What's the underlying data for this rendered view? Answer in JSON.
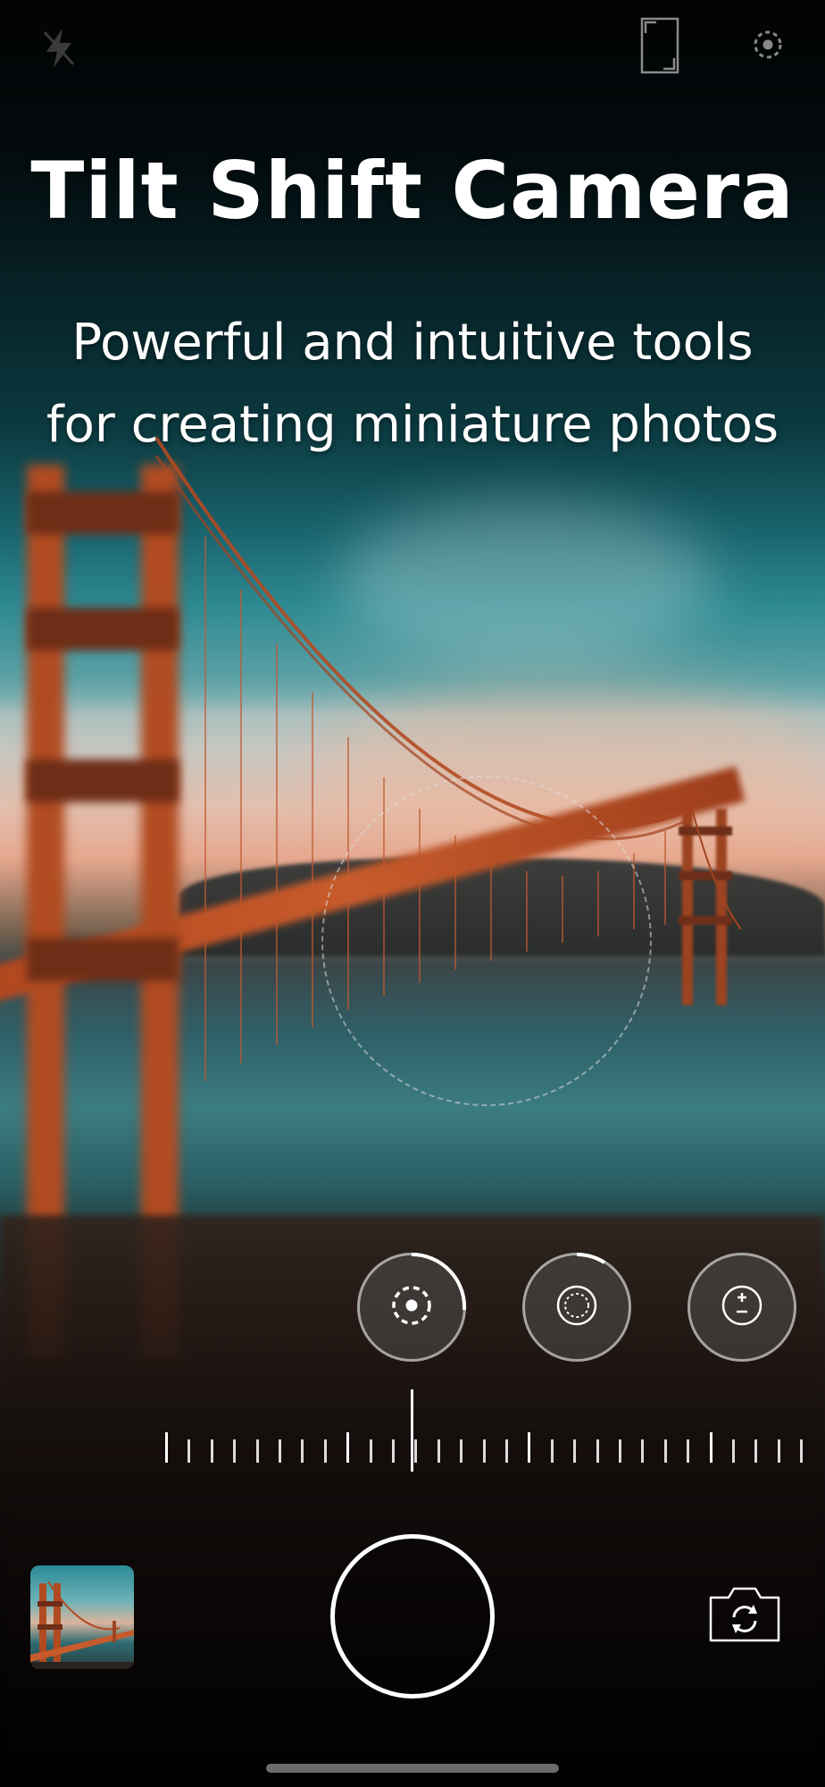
{
  "header": {
    "title": "Tilt Shift Camera",
    "subtitle_line1": "Powerful and intuitive tools",
    "subtitle_line2": "for creating miniature photos"
  },
  "toolbar": {
    "flash_icon": "flash-off-icon",
    "aspect_icon": "aspect-ratio-icon",
    "settings_icon": "settings-dots-icon"
  },
  "controls": {
    "items": [
      {
        "name": "focus-radius-control",
        "icon": "focus-dots-icon",
        "active": true
      },
      {
        "name": "blur-control",
        "icon": "blur-circle-icon",
        "active": false
      },
      {
        "name": "exposure-control",
        "icon": "exposure-plus-minus-icon",
        "active": false
      }
    ]
  },
  "bottom": {
    "gallery_icon": "gallery-thumbnail",
    "shutter_icon": "shutter-button",
    "switch_icon": "switch-camera-icon"
  },
  "colors": {
    "accent": "#ffffff",
    "bridge": "#c0522a",
    "sky": "#2f8a92"
  }
}
